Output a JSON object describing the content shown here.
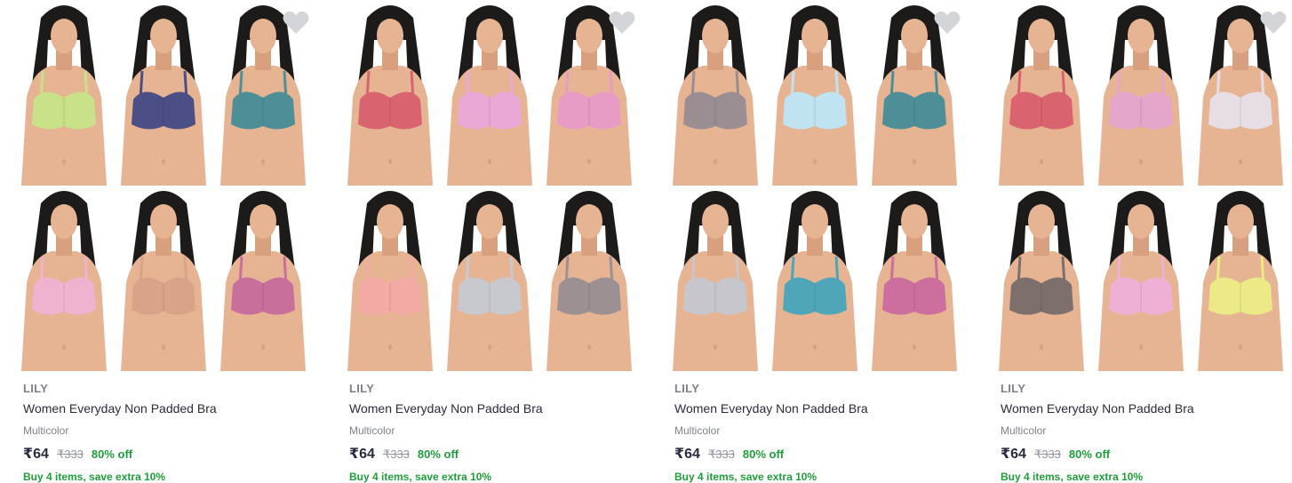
{
  "products": [
    {
      "brand": "LILY",
      "title": "Women Everyday Non Padded Bra",
      "color": "Multicolor",
      "price": "₹64",
      "mrp": "₹333",
      "discount": "80% off",
      "offer": "Buy 4 items, save extra 10%",
      "wishlist_icon": "heart-icon",
      "bra_colors": [
        "#c9e28a",
        "#4b4f86",
        "#4e8f97",
        "#efb3cf",
        "#d9a38a",
        "#c86f9c"
      ]
    },
    {
      "brand": "LILY",
      "title": "Women Everyday Non Padded Bra",
      "color": "Multicolor",
      "price": "₹64",
      "mrp": "₹333",
      "discount": "80% off",
      "offer": "Buy 4 items, save extra 10%",
      "wishlist_icon": "heart-icon",
      "bra_colors": [
        "#d9636e",
        "#e9a8d6",
        "#e89bc5",
        "#f3a9a4",
        "#c8c9cf",
        "#9c9093"
      ]
    },
    {
      "brand": "LILY",
      "title": "Women Everyday Non Padded Bra",
      "color": "Multicolor",
      "price": "₹64",
      "mrp": "₹333",
      "discount": "80% off",
      "offer": "Buy 4 items, save extra 10%",
      "wishlist_icon": "heart-icon",
      "bra_colors": [
        "#9b8e92",
        "#bfe3f0",
        "#4e8f97",
        "#c6c6cc",
        "#4ea6b8",
        "#cc6f9e"
      ]
    },
    {
      "brand": "LILY",
      "title": "Women Everyday Non Padded Bra",
      "color": "Multicolor",
      "price": "₹64",
      "mrp": "₹333",
      "discount": "80% off",
      "offer": "Buy 4 items, save extra 10%",
      "wishlist_icon": "heart-icon",
      "bra_colors": [
        "#d9636e",
        "#e5a6cb",
        "#e6dde5",
        "#7d6f6b",
        "#efb0d5",
        "#ecea86"
      ]
    }
  ]
}
